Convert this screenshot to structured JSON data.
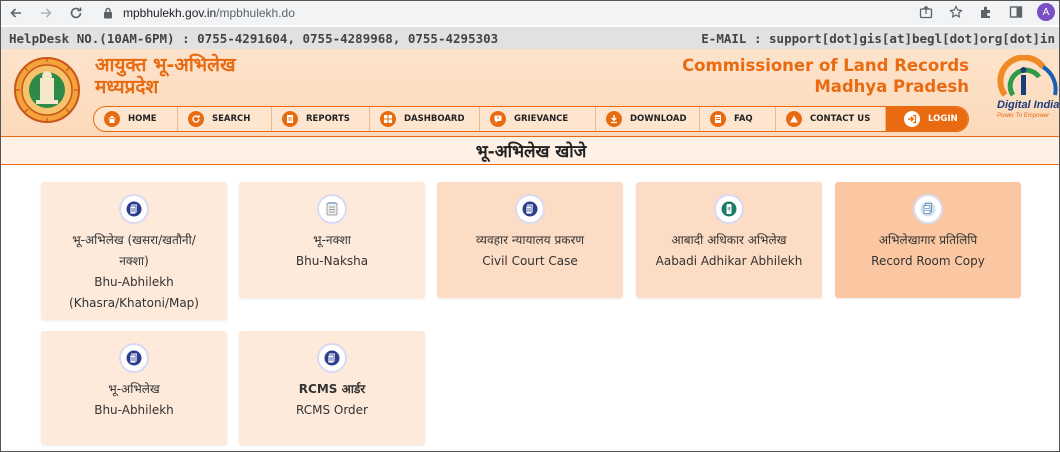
{
  "browser": {
    "url_host": "mpbhulekh.gov.in",
    "url_path": "/mpbhulekh.do",
    "avatar_letter": "A"
  },
  "helpdesk": {
    "left": "HelpDesk NO.(10AM-6PM) : 0755-4291604, 0755-4289968, 0755-4295303",
    "right": "E-MAIL : support[dot]gis[at]begl[dot]org[dot]in"
  },
  "header": {
    "hindi_line1": "आयुक्त भू-अभिलेख",
    "hindi_line2": "मध्यप्रदेश",
    "english_line1": "Commissioner of Land Records",
    "english_line2": "Madhya Pradesh",
    "digital_india": "Digital India",
    "digital_india_tagline": "Power To Empower"
  },
  "menu": {
    "items": [
      {
        "label": "HOME",
        "icon": "home-icon"
      },
      {
        "label": "SEARCH",
        "icon": "refresh-icon"
      },
      {
        "label": "REPORTS",
        "icon": "document-icon"
      },
      {
        "label": "DASHBOARD",
        "icon": "grid-icon"
      },
      {
        "label": "GRIEVANCE",
        "icon": "alert-icon"
      },
      {
        "label": "DOWNLOAD",
        "icon": "download-icon"
      },
      {
        "label": "FAQ",
        "icon": "list-icon"
      },
      {
        "label": "CONTACT US",
        "icon": "triangle-icon"
      },
      {
        "label": "LOGIN",
        "icon": "login-icon"
      }
    ]
  },
  "page_heading": "भू-अभिलेख खोजे",
  "tiles": [
    {
      "line1": "भू-अभिलेख (खसरा/खतौनी/",
      "line2": "नक्शा)",
      "line3": "Bhu-Abhilekh",
      "line4": "(Khasra/Khatoni/Map)",
      "icon": "document-icon"
    },
    {
      "line1": "भू-नक्शा",
      "line2": "Bhu-Naksha",
      "icon": "notepad-icon"
    },
    {
      "line1": "व्यवहार न्यायालय प्रकरण",
      "line2": "Civil Court Case",
      "icon": "document-icon"
    },
    {
      "line1": "आबादी अधिकार अभिलेख",
      "line2": "Aabadi Adhikar Abhilekh",
      "icon": "money-icon"
    },
    {
      "line1": "अभिलेखागार प्रतिलिपि",
      "line2": "Record Room Copy",
      "icon": "copy-icon"
    },
    {
      "line1": "भू-अभिलेख",
      "line2": "Bhu-Abhilekh",
      "icon": "document-icon"
    },
    {
      "line1": "RCMS आर्डर",
      "line2": "RCMS Order",
      "icon": "document-icon"
    }
  ],
  "colors": {
    "accent": "#e86b12",
    "tile_light": "#fdeadb",
    "tile_strong": "#fbc7a2"
  }
}
